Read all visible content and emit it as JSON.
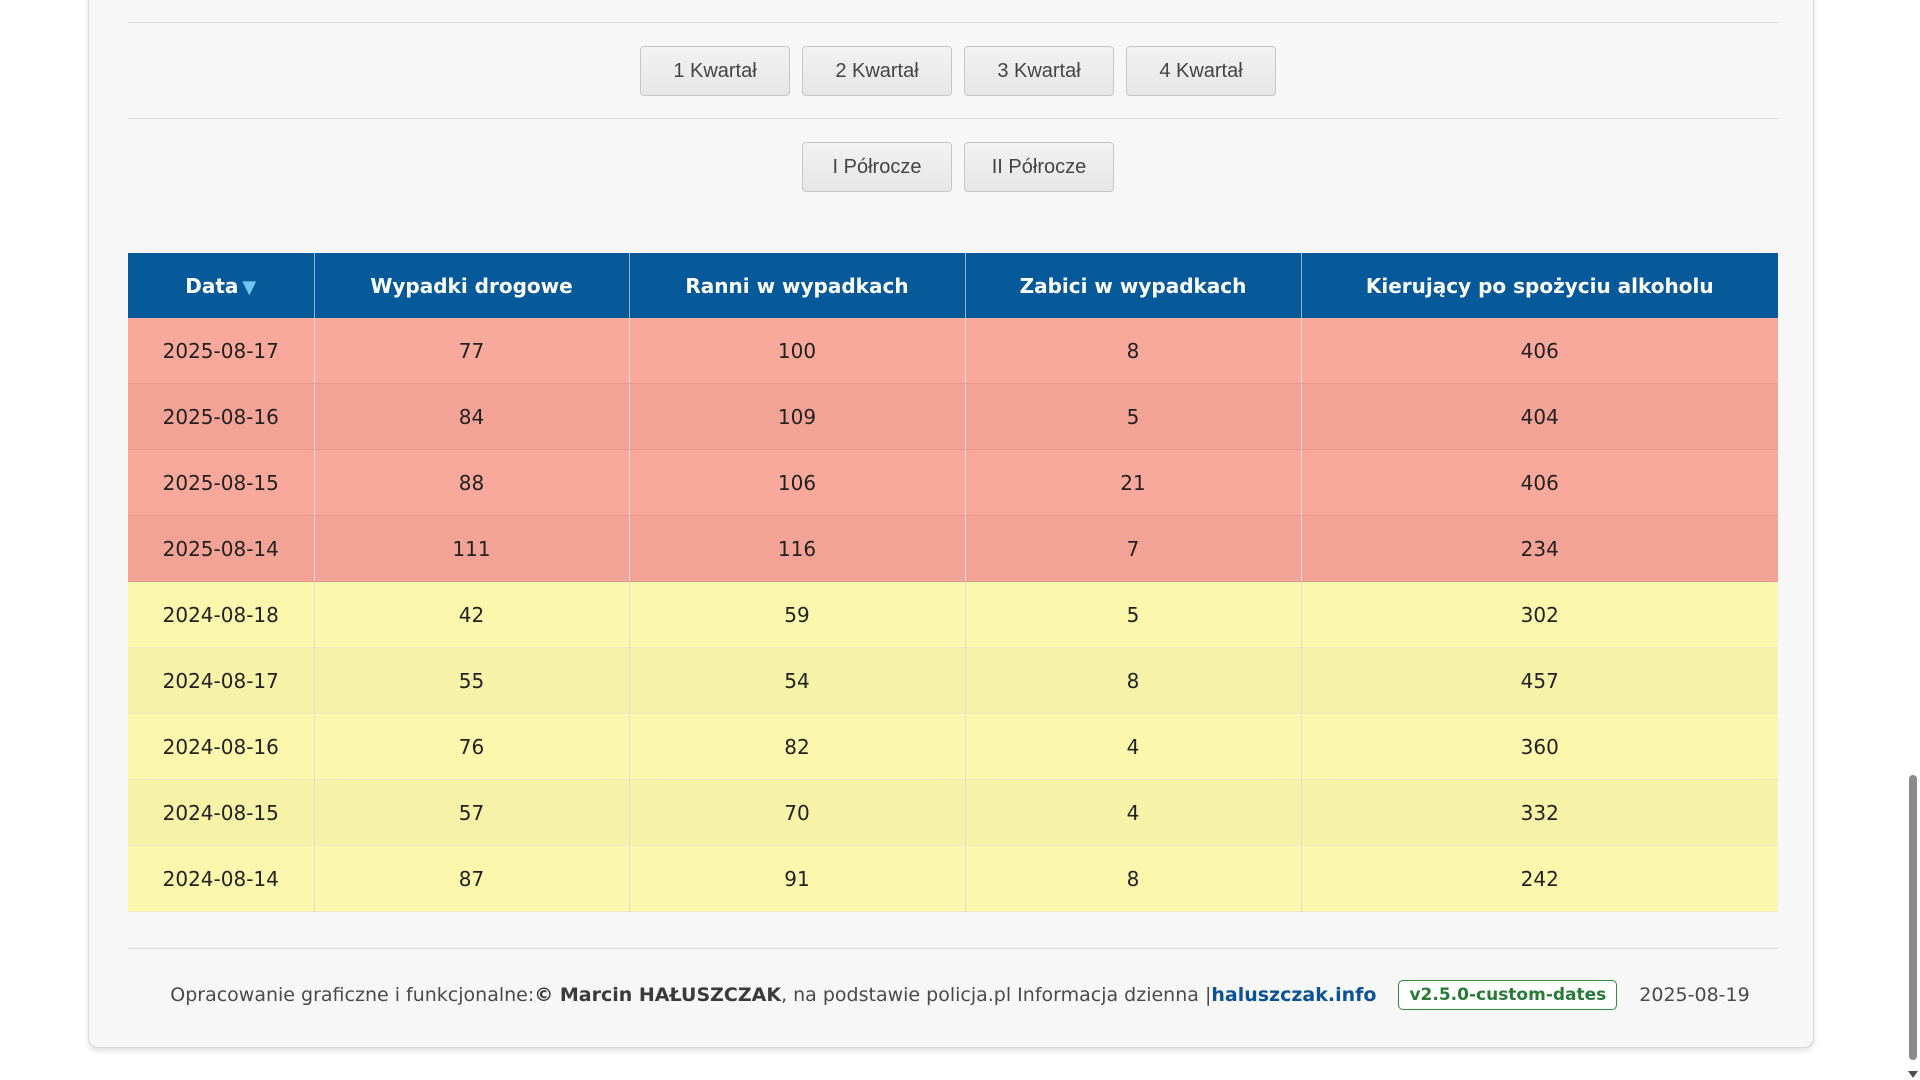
{
  "filters": {
    "quarters": [
      "1 Kwartał",
      "2 Kwartał",
      "3 Kwartał",
      "4 Kwartał"
    ],
    "halves": [
      "I Półrocze",
      "II Półrocze"
    ]
  },
  "table": {
    "headers": [
      "Data",
      "Wypadki drogowe",
      "Ranni w wypadkach",
      "Zabici w wypadkach",
      "Kierujący po spożyciu alkoholu"
    ],
    "sort_indicator": "▼",
    "rows": [
      {
        "date": "2025-08-17",
        "wypadki": "77",
        "ranni": "100",
        "zabici": "8",
        "alkohol": "406"
      },
      {
        "date": "2025-08-16",
        "wypadki": "84",
        "ranni": "109",
        "zabici": "5",
        "alkohol": "404"
      },
      {
        "date": "2025-08-15",
        "wypadki": "88",
        "ranni": "106",
        "zabici": "21",
        "alkohol": "406"
      },
      {
        "date": "2025-08-14",
        "wypadki": "111",
        "ranni": "116",
        "zabici": "7",
        "alkohol": "234"
      },
      {
        "date": "2024-08-18",
        "wypadki": "42",
        "ranni": "59",
        "zabici": "5",
        "alkohol": "302"
      },
      {
        "date": "2024-08-17",
        "wypadki": "55",
        "ranni": "54",
        "zabici": "8",
        "alkohol": "457"
      },
      {
        "date": "2024-08-16",
        "wypadki": "76",
        "ranni": "82",
        "zabici": "4",
        "alkohol": "360"
      },
      {
        "date": "2024-08-15",
        "wypadki": "57",
        "ranni": "70",
        "zabici": "4",
        "alkohol": "332"
      },
      {
        "date": "2024-08-14",
        "wypadki": "87",
        "ranni": "91",
        "zabici": "8",
        "alkohol": "242"
      }
    ]
  },
  "colors": {
    "header_bg": "#065a99",
    "current_year_row": "#f9a99b",
    "previous_year_row": "#fbf8ad"
  },
  "footer": {
    "prefix": "Opracowanie graficzne i funkcjonalne: ",
    "author": "© Marcin HAŁUSZCZAK",
    "middle": ", na podstawie policja.pl Informacja dzienna | ",
    "link": "haluszczak.info",
    "version": "v2.5.0-custom-dates",
    "date": "2025-08-19"
  }
}
